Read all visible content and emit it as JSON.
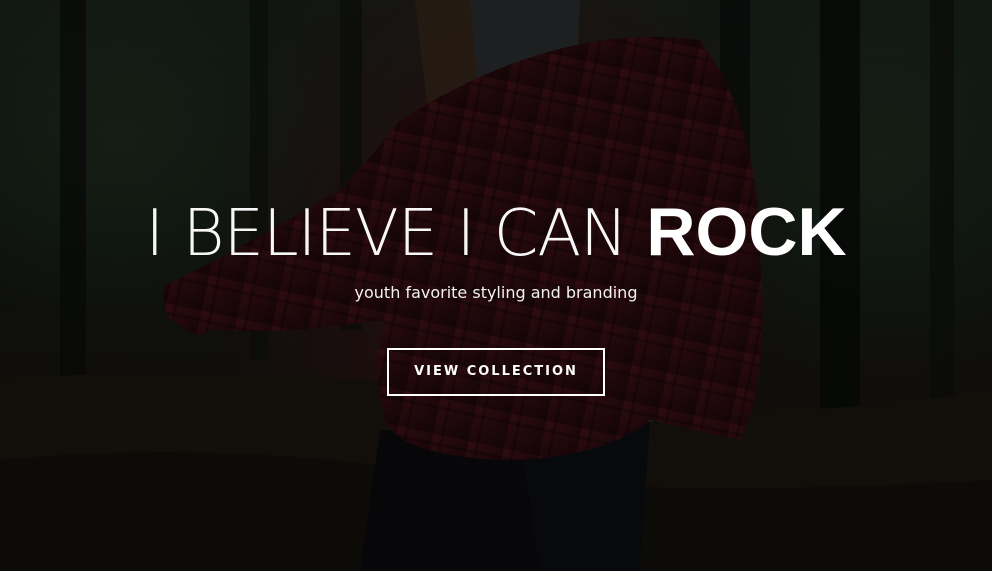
{
  "hero": {
    "headline_light": "I BELIEVE I CAN ",
    "headline_bold": "ROCK",
    "subtitle": "youth favorite styling and branding",
    "cta_label": "VIEW COLLECTION"
  }
}
